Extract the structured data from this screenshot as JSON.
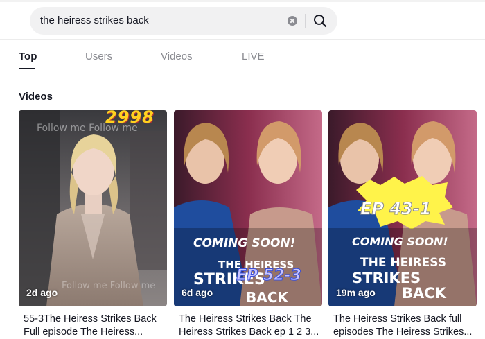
{
  "search": {
    "query": "the heiress strikes back",
    "clear_icon": "clear-icon",
    "search_icon": "search-icon"
  },
  "tabs": [
    {
      "label": "Top",
      "active": true
    },
    {
      "label": "Users",
      "active": false
    },
    {
      "label": "Videos",
      "active": false
    },
    {
      "label": "LIVE",
      "active": false
    }
  ],
  "section": {
    "title": "Videos"
  },
  "videos": [
    {
      "age": "2d ago",
      "title_line1": "55-3The Heiress Strikes Back",
      "title_line2": "Full episode The Heiress...",
      "overlay_top": "2998",
      "overlay_faded": "Follow me Follow me",
      "overlay_faded_bottom": "Follow me Follow me"
    },
    {
      "age": "6d ago",
      "title_line1": "The Heiress Strikes Back The",
      "title_line2": "Heiress Strikes Back ep 1 2 3...",
      "overlay_banner": "COMING SOON!",
      "overlay_logo_line1": "THE HEIRESS",
      "overlay_logo_line2": "STRIKES",
      "overlay_logo_line3": "BACK",
      "overlay_ep": "EP 52-3"
    },
    {
      "age": "19m ago",
      "title_line1": "The Heiress Strikes Back full",
      "title_line2": "episodes The Heiress Strikes...",
      "overlay_banner": "COMING SOON!",
      "overlay_logo_line1": "THE HEIRESS",
      "overlay_logo_line2": "STRIKES",
      "overlay_logo_line3": "BACK",
      "overlay_ep": "EP 43-1"
    }
  ]
}
